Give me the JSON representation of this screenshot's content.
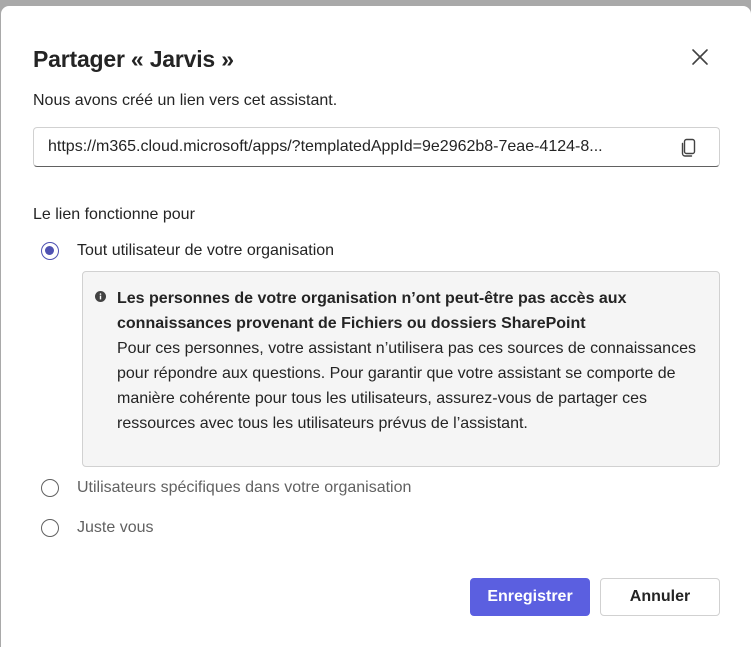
{
  "dialog": {
    "title": "Partager « Jarvis »",
    "subtitle": "Nous avons créé un lien vers cet assistant.",
    "link_value": "https://m365.cloud.microsoft/apps/?templatedAppId=9e2962b8-7eae-4124-8...",
    "section_label": "Le lien fonctionne pour",
    "options": [
      {
        "label": "Tout utilisateur de votre organisation",
        "selected": true
      },
      {
        "label": "Utilisateurs spécifiques dans votre organisation",
        "selected": false
      },
      {
        "label": "Juste vous",
        "selected": false
      }
    ],
    "info": {
      "heading": "Les personnes de votre organisation n’ont peut-être pas accès aux connaissances provenant de Fichiers ou dossiers SharePoint",
      "body": "Pour ces personnes, votre assistant n’utilisera pas ces sources de connaissances pour répondre aux questions. Pour garantir que votre assistant se comporte de manière cohérente pour tous les utilisateurs, assurez-vous de partager ces ressources avec tous les utilisateurs prévus de l’assistant."
    },
    "buttons": {
      "save": "Enregistrer",
      "cancel": "Annuler"
    }
  },
  "icons": {
    "close": "close-icon",
    "copy": "copy-icon",
    "info": "info-icon"
  },
  "colors": {
    "accent": "#5b5fe0",
    "radio_selected": "#4f52b2",
    "info_background": "#f5f5f5"
  }
}
